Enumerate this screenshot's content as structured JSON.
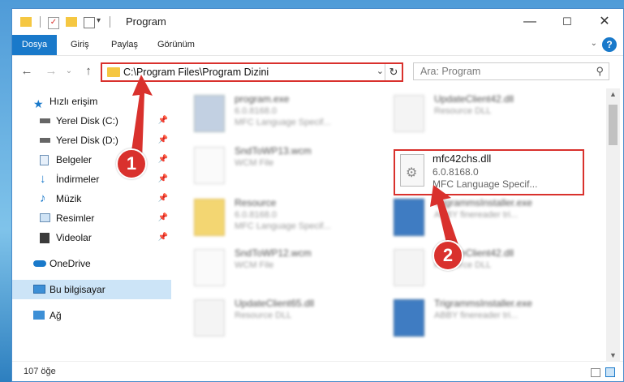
{
  "window": {
    "title": "Program",
    "minimize": "—",
    "maximize": "☐",
    "close": "✕"
  },
  "ribbon": {
    "tabs": [
      "Dosya",
      "Giriş",
      "Paylaş",
      "Görünüm"
    ],
    "help": "?"
  },
  "nav": {
    "back": "←",
    "forward": "→",
    "up": "↑",
    "address": "C:\\Program Files\\Program Dizini",
    "refresh": "↻",
    "search_placeholder": "Ara: Program",
    "search_icon": "⚲"
  },
  "sidebar": {
    "items": [
      {
        "label": "Hızlı erişim",
        "icon": "star-icon"
      },
      {
        "label": "Yerel Disk (C:)",
        "icon": "drive-icon",
        "pinned": true
      },
      {
        "label": "Yerel Disk (D:)",
        "icon": "drive-icon",
        "pinned": true
      },
      {
        "label": "Belgeler",
        "icon": "documents-icon",
        "pinned": true
      },
      {
        "label": "İndirmeler",
        "icon": "downloads-icon",
        "pinned": true
      },
      {
        "label": "Müzik",
        "icon": "music-icon",
        "pinned": true
      },
      {
        "label": "Resimler",
        "icon": "pictures-icon",
        "pinned": true
      },
      {
        "label": "Videolar",
        "icon": "videos-icon",
        "pinned": true
      },
      {
        "label": "OneDrive",
        "icon": "cloud-icon"
      },
      {
        "label": "Bu bilgisayar",
        "icon": "computer-icon",
        "selected": true
      },
      {
        "label": "Ağ",
        "icon": "network-icon"
      }
    ]
  },
  "files": [
    {
      "name": "program.exe",
      "line1": "6.0.8168.0",
      "line2": "MFC Language Specif..."
    },
    {
      "name": "UpdateClient42.dll",
      "line1": "Resource DLL",
      "line2": ""
    },
    {
      "name": "SndToWP13.wcm",
      "line1": "WCM File",
      "line2": ""
    },
    {
      "name": "mfc42chs.dll",
      "line1": "6.0.8168.0",
      "line2": "MFC Language Specif..."
    },
    {
      "name": "Resource",
      "line1": "6.0.8168.0",
      "line2": "MFC Language Specif..."
    },
    {
      "name": "TrigrammsInstaller.exe",
      "line1": "ABBY finereader tri...",
      "line2": ""
    },
    {
      "name": "SndToWP12.wcm",
      "line1": "WCM File",
      "line2": ""
    },
    {
      "name": "UpdateClient42.dll",
      "line1": "Resource DLL",
      "line2": ""
    },
    {
      "name": "UpdateClient65.dll",
      "line1": "Resource DLL",
      "line2": ""
    },
    {
      "name": "TrigrammsInstaller.exe",
      "line1": "ABBY finereader tri...",
      "line2": ""
    }
  ],
  "status": {
    "count": "107 öğe"
  },
  "annotations": {
    "badge1": "1",
    "badge2": "2"
  },
  "colors": {
    "accent": "#1979ca",
    "highlight": "#d9312d",
    "selection": "#cce4f7"
  }
}
